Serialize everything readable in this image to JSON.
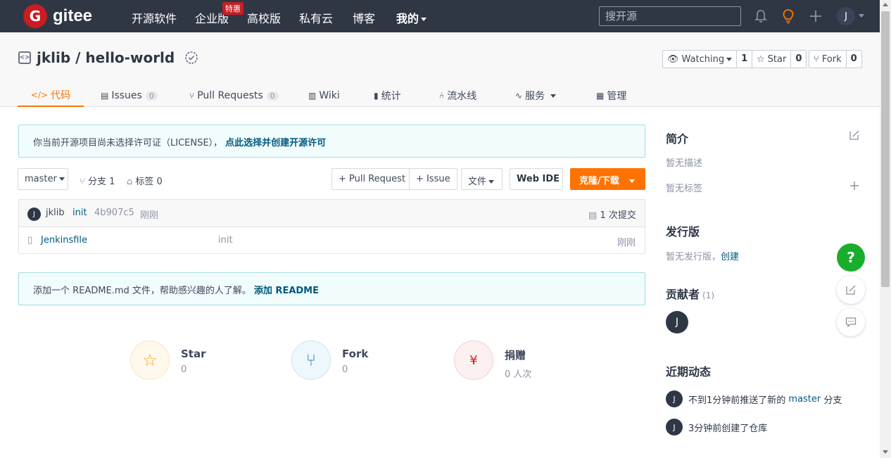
{
  "topnav": {
    "logo_text": "gitee",
    "logo_glyph": "G",
    "items": [
      "开源软件",
      "企业版",
      "高校版",
      "私有云",
      "博客",
      "我的"
    ],
    "special_badge": "特惠",
    "search_placeholder": "搜开源",
    "avatar_letter": "J",
    "colors": {
      "bg": "#2f3745",
      "brand": "#c71d23"
    }
  },
  "repo": {
    "owner": "jklib",
    "separator": " / ",
    "name": "hello-world",
    "watch": {
      "label": "Watching",
      "count": "1"
    },
    "star": {
      "label": "Star",
      "count": "0"
    },
    "fork": {
      "label": "Fork",
      "count": "0"
    }
  },
  "tabs": [
    {
      "icon": "</>",
      "label": "代码"
    },
    {
      "icon": "▤",
      "label": "Issues",
      "count": "0"
    },
    {
      "icon": "⑂",
      "label": "Pull Requests",
      "count": "0"
    },
    {
      "icon": "▥",
      "label": "Wiki"
    },
    {
      "icon": "▮",
      "label": "统计"
    },
    {
      "icon": "⑃",
      "label": "流水线"
    },
    {
      "icon": "∿",
      "label": "服务"
    },
    {
      "icon": "▦",
      "label": "管理"
    }
  ],
  "license_notice": {
    "text": "你当前开源项目尚未选择许可证（LICENSE），",
    "link": "点此选择并创建开源许可"
  },
  "branchbar": {
    "branch": "master",
    "branches": "分支 1",
    "tags": "标签 0",
    "pr_button": "+ Pull Request",
    "issue_button": "+ Issue",
    "file_button": "文件",
    "webide_button": "Web IDE",
    "clone_button": "克隆/下载"
  },
  "commit": {
    "avatar_letter": "J",
    "author": "jklib",
    "message": "init",
    "hash": "4b907c5",
    "time": "刚刚",
    "commits": "1 次提交"
  },
  "files": [
    {
      "name": "Jenkinsfile",
      "message": "init",
      "time": "刚刚"
    }
  ],
  "readme_notice": {
    "text": "添加一个 README.md 文件，帮助感兴趣的人了解。",
    "link": "添加 README"
  },
  "bottom_stats": [
    {
      "label": "Star",
      "value": "0",
      "icon": "star-icon"
    },
    {
      "label": "Fork",
      "value": "0",
      "icon": "fork-icon"
    },
    {
      "label": "捐赠",
      "value": "0 人次",
      "icon": "donate-icon"
    }
  ],
  "sidebar": {
    "intro_title": "简介",
    "no_desc": "暂无描述",
    "no_tags": "暂无标签",
    "release_title": "发行版",
    "no_release": "暂无发行版，",
    "create_link": "创建",
    "contributors_title": "贡献者",
    "contributors_count": "(1)",
    "contributor_letter": "J",
    "activity_title": "近期动态",
    "activity": [
      {
        "letter": "J",
        "prefix": "不到1分钟前推送了新的 ",
        "branch": "master",
        "suffix": " 分支"
      },
      {
        "letter": "J",
        "prefix": "3分钟前创建了仓库",
        "branch": "",
        "suffix": ""
      }
    ]
  },
  "floating": {
    "help": "?"
  },
  "colors": {
    "accent": "#fe7300",
    "link": "#005980",
    "help_green": "#19ad2c"
  }
}
